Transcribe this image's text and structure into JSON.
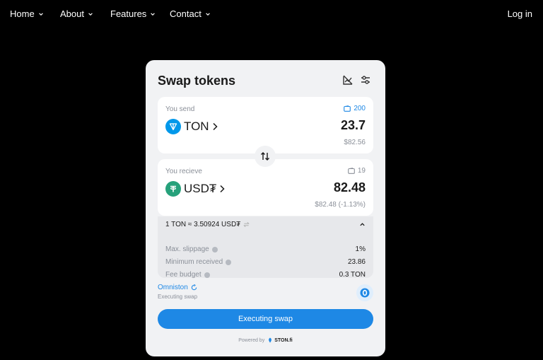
{
  "nav": {
    "items": [
      {
        "label": "Home"
      },
      {
        "label": "About"
      },
      {
        "label": "Features"
      },
      {
        "label": "Contact"
      }
    ],
    "login_label": "Log in"
  },
  "swap": {
    "title": "Swap tokens",
    "send": {
      "label": "You send",
      "balance": "200",
      "token": "TON",
      "amount": "23.7",
      "usd": "$82.56"
    },
    "receive": {
      "label": "You recieve",
      "balance": "19",
      "token": "USD₮",
      "amount": "82.48",
      "usd": "$82.48 (-1.13%)"
    },
    "rate": "1 TON ≈ 3.50924 USD₮",
    "details": [
      {
        "key": "Max. slippage",
        "value": "1%"
      },
      {
        "key": "Minimum received",
        "value": "23.86"
      },
      {
        "key": "Fee budget",
        "value": "0.3 TON"
      }
    ],
    "provider": {
      "name": "Omniston",
      "status": "Executing swap"
    },
    "action_label": "Executing swap",
    "powered_prefix": "Powered by",
    "powered_brand": "STON.fi"
  },
  "colors": {
    "accent": "#1e88e5",
    "ton": "#0098ea",
    "usdt": "#26a17b",
    "card_bg": "#f1f2f4"
  }
}
